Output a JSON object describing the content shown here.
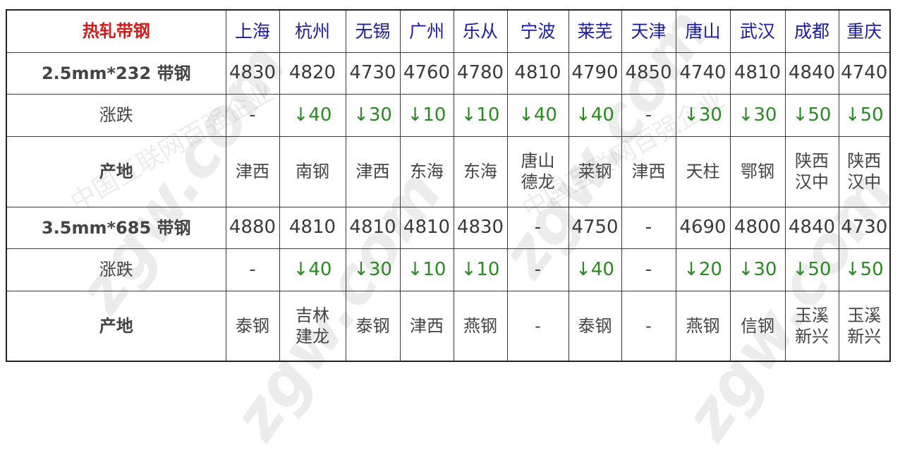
{
  "table": {
    "title": "热轧带钢",
    "cities": [
      "上海",
      "杭州",
      "无锡",
      "广州",
      "乐从",
      "宁波",
      "莱芜",
      "天津",
      "唐山",
      "武汉",
      "成都",
      "重庆"
    ],
    "sections": [
      {
        "spec": "2.5mm*232 带钢",
        "prices": [
          "4830",
          "4820",
          "4730",
          "4760",
          "4780",
          "4810",
          "4790",
          "4850",
          "4740",
          "4810",
          "4840",
          "4740"
        ],
        "change_label": "涨跌",
        "changes": [
          "-",
          "↓40",
          "↓30",
          "↓10",
          "↓10",
          "↓40",
          "↓40",
          "-",
          "↓30",
          "↓30",
          "↓50",
          "↓50"
        ],
        "origin_label": "产地",
        "origins": [
          [
            "津西"
          ],
          [
            "南钢"
          ],
          [
            "津西"
          ],
          [
            "东海"
          ],
          [
            "东海"
          ],
          [
            "唐山",
            "德龙"
          ],
          [
            "莱钢"
          ],
          [
            "津西"
          ],
          [
            "天柱"
          ],
          [
            "鄂钢"
          ],
          [
            "陕西",
            "汉中"
          ],
          [
            "陕西",
            "汉中"
          ]
        ]
      },
      {
        "spec": "3.5mm*685 带钢",
        "prices": [
          "4880",
          "4810",
          "4810",
          "4810",
          "4830",
          "-",
          "4750",
          "-",
          "4690",
          "4800",
          "4840",
          "4730"
        ],
        "change_label": "涨跌",
        "changes": [
          "-",
          "↓40",
          "↓30",
          "↓10",
          "↓10",
          "-",
          "↓40",
          "-",
          "↓20",
          "↓30",
          "↓50",
          "↓50"
        ],
        "origin_label": "产地",
        "origins": [
          [
            "泰钢"
          ],
          [
            "吉林",
            "建龙"
          ],
          [
            "泰钢"
          ],
          [
            "津西"
          ],
          [
            "燕钢"
          ],
          [
            "-"
          ],
          [
            "泰钢"
          ],
          [
            "-"
          ],
          [
            "燕钢"
          ],
          [
            "信钢"
          ],
          [
            "玉溪",
            "新兴"
          ],
          [
            "玉溪",
            "新兴"
          ]
        ]
      }
    ]
  },
  "watermark": {
    "logo_text": "zgw.com",
    "caption": "中国互联网百强企业"
  },
  "colors": {
    "title": "#d11a1a",
    "city_header": "#1c1ca0",
    "change_down": "#2a8a22"
  }
}
